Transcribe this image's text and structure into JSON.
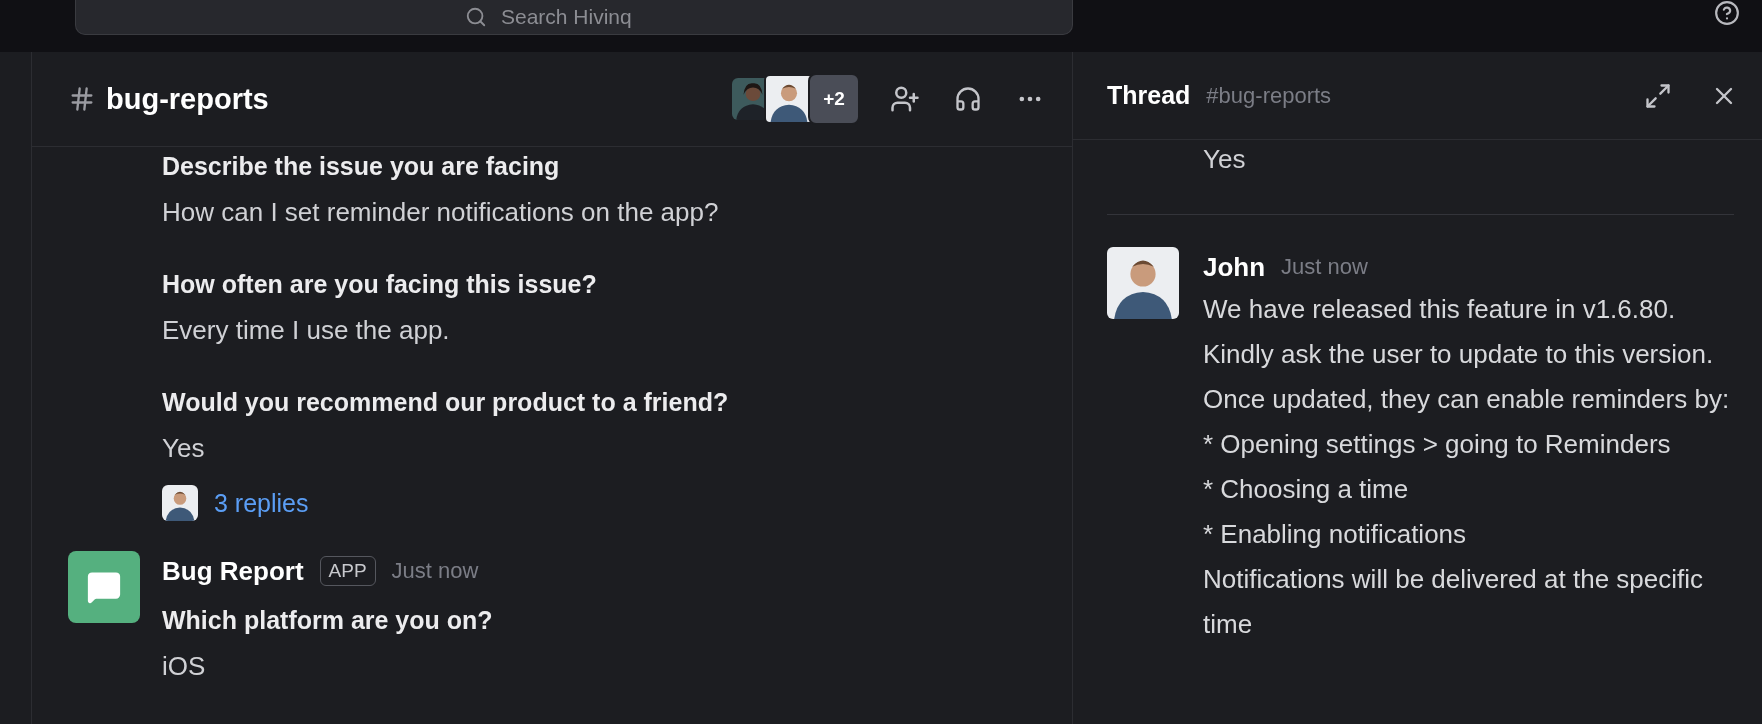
{
  "search": {
    "placeholder": "Search Hivinq"
  },
  "channel": {
    "name": "bug-reports",
    "member_overflow": "+2"
  },
  "messages": [
    {
      "kind": "continued",
      "fields": [
        {
          "question": "Describe the issue you are facing",
          "answer": "How can I set reminder notifications on the app?"
        },
        {
          "question": "How often are you facing this issue?",
          "answer": "Every time I use the app."
        },
        {
          "question": "Would you recommend our product to a friend?",
          "answer": "Yes"
        }
      ],
      "replies": "3 replies"
    },
    {
      "kind": "app",
      "author": "Bug Report",
      "badge": "APP",
      "time": "Just now",
      "fields": [
        {
          "question": "Which platform are you on?",
          "answer": "iOS"
        }
      ]
    }
  ],
  "thread": {
    "title": "Thread",
    "channel": "#bug-reports",
    "previous_answer": "Yes",
    "reply": {
      "author": "John",
      "time": "Just now",
      "paragraphs": [
        "We have released this feature in v1.6.80. Kindly ask the user to update to this version. Once updated, they can enable reminders by:",
        "* Opening settings > going to Reminders",
        "* Choosing a time",
        "* Enabling notifications",
        "Notifications will be delivered at the specific time"
      ]
    }
  }
}
